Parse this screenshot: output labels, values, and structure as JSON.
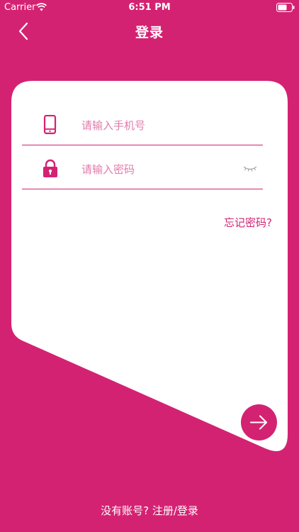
{
  "status_bar": {
    "carrier": "Carrier",
    "time": "6:51 PM",
    "wifi_icon": "wifi-icon",
    "battery_icon": "battery-icon"
  },
  "nav": {
    "back_icon": "chevron-left-icon",
    "title": "登录"
  },
  "form": {
    "phone": {
      "icon": "smartphone-icon",
      "placeholder": "请输入手机号",
      "value": ""
    },
    "password": {
      "icon": "lock-icon",
      "placeholder": "请输入密码",
      "value": "",
      "toggle_icon": "eye-closed-icon"
    },
    "forgot_label": "忘记密码?",
    "submit_icon": "arrow-right-icon"
  },
  "footer": {
    "register_label": "没有账号? 注册/登录"
  },
  "colors": {
    "brand": "#D42273",
    "card": "#FFFFFF",
    "placeholder": "#E07BAB"
  }
}
